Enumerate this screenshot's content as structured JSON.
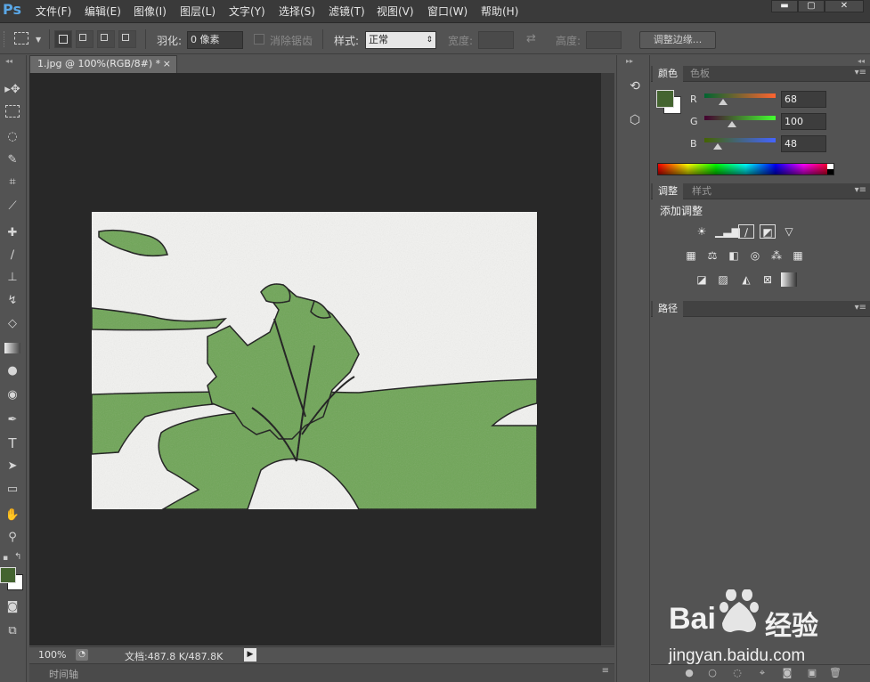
{
  "app": {
    "logo": "Ps"
  },
  "menu": [
    {
      "label": "文件(F)"
    },
    {
      "label": "编辑(E)"
    },
    {
      "label": "图像(I)"
    },
    {
      "label": "图层(L)"
    },
    {
      "label": "文字(Y)"
    },
    {
      "label": "选择(S)"
    },
    {
      "label": "滤镜(T)"
    },
    {
      "label": "视图(V)"
    },
    {
      "label": "窗口(W)"
    },
    {
      "label": "帮助(H)"
    }
  ],
  "options": {
    "feather_label": "羽化:",
    "feather_value": "0 像素",
    "antialias_label": "消除锯齿",
    "style_label": "样式:",
    "style_value": "正常",
    "width_label": "宽度:",
    "height_label": "高度:",
    "refine_edge_label": "调整边缘..."
  },
  "document": {
    "tab_title": "1.jpg @ 100%(RGB/8#) *",
    "zoom": "100%",
    "doc_size": "文档:487.8 K/487.8K"
  },
  "timeline": {
    "label": "时间轴"
  },
  "color_panel": {
    "tabs": [
      "颜色",
      "色板"
    ],
    "channels": [
      {
        "name": "R",
        "value": "68",
        "level": 0.267
      },
      {
        "name": "G",
        "value": "100",
        "level": 0.392
      },
      {
        "name": "B",
        "value": "48",
        "level": 0.188
      }
    ],
    "foreground": "#446430",
    "background": "#ffffff"
  },
  "adjustments_panel": {
    "tabs": [
      "调整",
      "样式"
    ],
    "title": "添加调整"
  },
  "paths_panel": {
    "tabs": [
      "路径"
    ]
  },
  "watermark": {
    "brand_left": "Bai",
    "brand_right": "经验",
    "url": "jingyan.baidu.com"
  }
}
